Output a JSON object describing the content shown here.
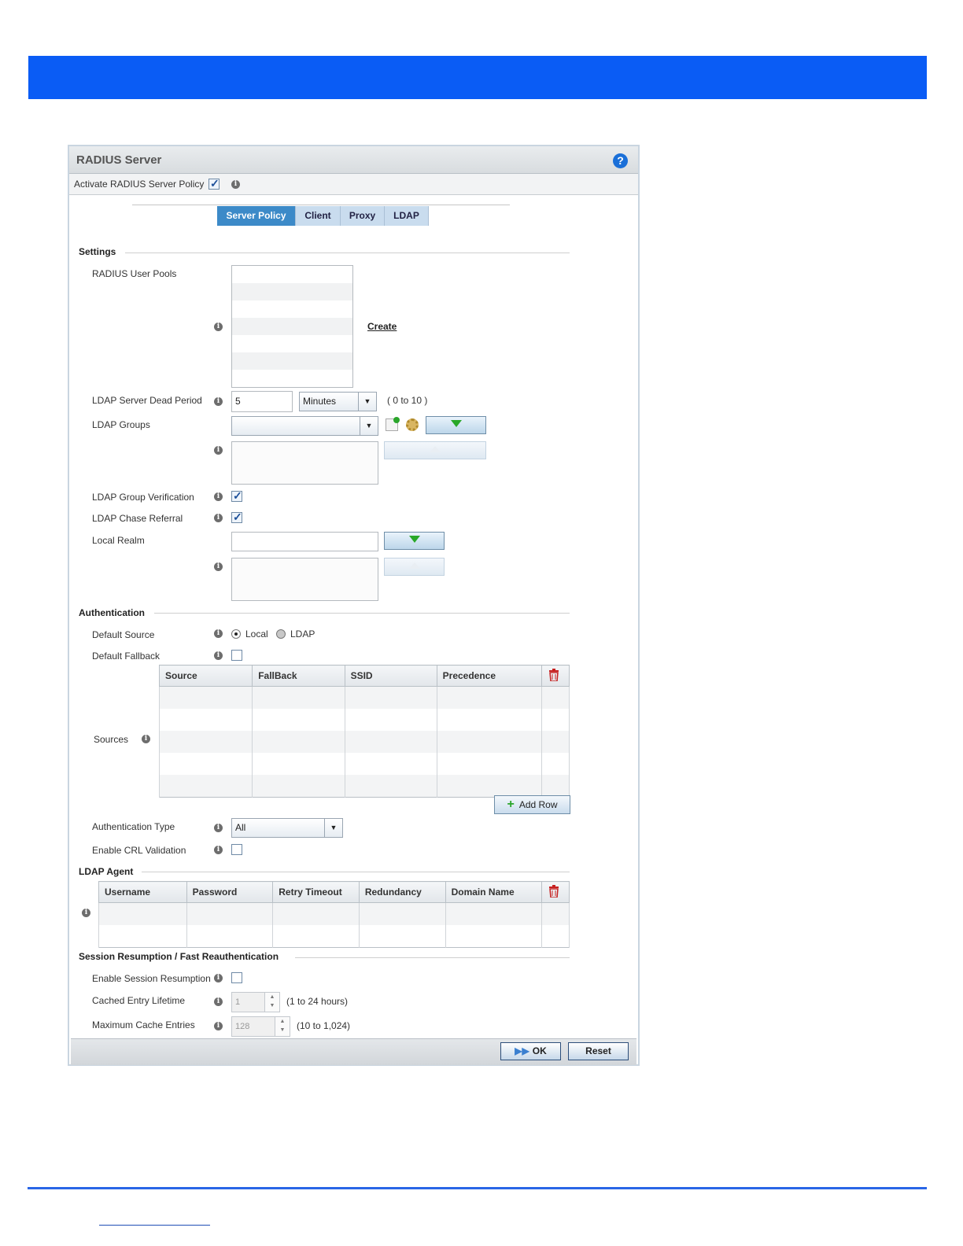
{
  "dialog": {
    "title": "RADIUS Server",
    "activate_label": "Activate RADIUS Server Policy",
    "activate_checked": true
  },
  "tabs": [
    {
      "label": "Server Policy",
      "active": true
    },
    {
      "label": "Client",
      "active": false
    },
    {
      "label": "Proxy",
      "active": false
    },
    {
      "label": "LDAP",
      "active": false
    }
  ],
  "settings": {
    "heading": "Settings",
    "user_pools_label": "RADIUS User Pools",
    "create_link": "Create",
    "dead_period_label": "LDAP Server Dead Period",
    "dead_period_value": "5",
    "dead_period_unit": "Minutes",
    "dead_period_range": "( 0 to 10 )",
    "ldap_groups_label": "LDAP Groups",
    "ldap_groups_value": "",
    "group_verification_label": "LDAP Group Verification",
    "group_verification_checked": true,
    "chase_referral_label": "LDAP Chase Referral",
    "chase_referral_checked": true,
    "local_realm_label": "Local Realm",
    "local_realm_value": ""
  },
  "authentication": {
    "heading": "Authentication",
    "default_source_label": "Default Source",
    "source_options": [
      "Local",
      "LDAP"
    ],
    "source_selected": "Local",
    "default_fallback_label": "Default Fallback",
    "default_fallback_checked": false,
    "sources_label": "Sources",
    "sources_columns": [
      "Source",
      "FallBack",
      "SSID",
      "Precedence"
    ],
    "add_row_label": "Add Row",
    "auth_type_label": "Authentication Type",
    "auth_type_value": "All",
    "crl_label": "Enable CRL Validation",
    "crl_checked": false
  },
  "ldap_agent": {
    "heading": "LDAP Agent",
    "columns": [
      "Username",
      "Password",
      "Retry Timeout",
      "Redundancy",
      "Domain Name"
    ]
  },
  "session": {
    "heading": "Session Resumption / Fast Reauthentication",
    "enable_label": "Enable Session Resumption",
    "enable_checked": false,
    "lifetime_label": "Cached Entry Lifetime",
    "lifetime_value": "1",
    "lifetime_range": "(1 to 24 hours)",
    "max_entries_label": "Maximum Cache Entries",
    "max_entries_value": "128",
    "max_entries_range": "(10 to 1,024)"
  },
  "footer": {
    "ok_label": "OK",
    "reset_label": "Reset"
  },
  "colors": {
    "banner": "#0a5cf5",
    "tab_active": "#3c8ac8",
    "tab_inactive": "#c9dcee"
  }
}
